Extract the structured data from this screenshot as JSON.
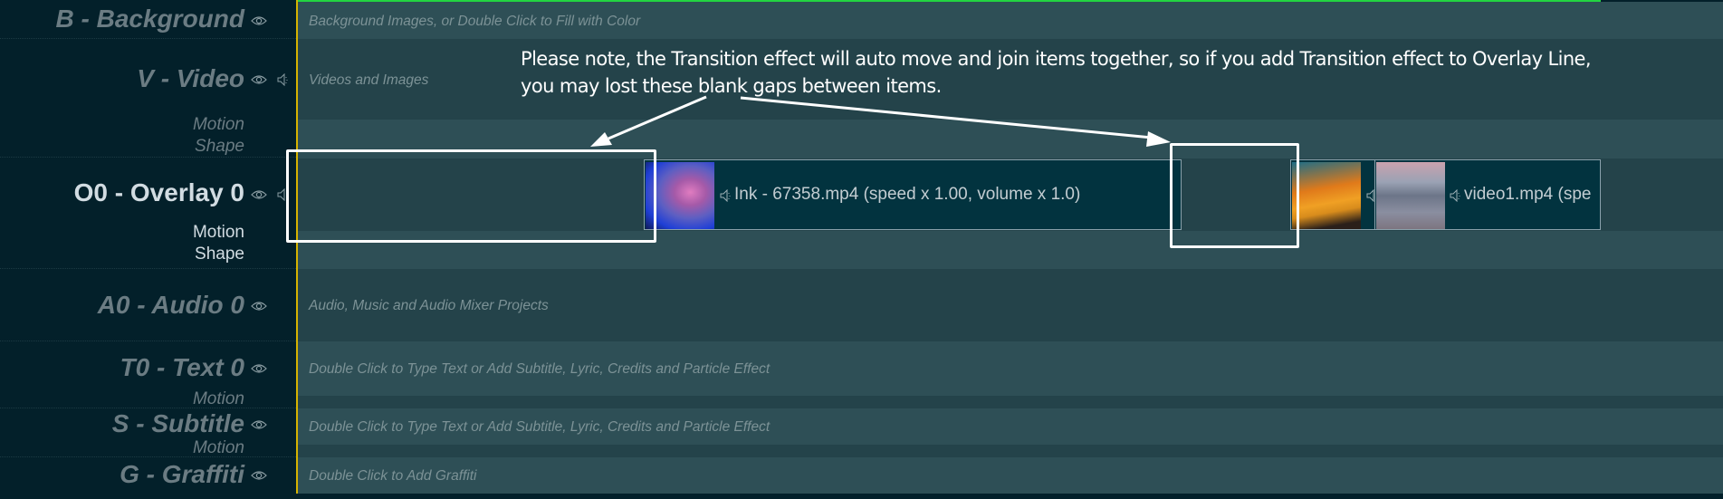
{
  "tracks": [
    {
      "id": "B",
      "label": "B - Background",
      "hint": "Background Images, or Double Click to Fill with Color",
      "icons": [
        "eye-icon"
      ]
    },
    {
      "id": "V",
      "label": "V - Video",
      "hint": "Videos and Images",
      "icons": [
        "eye-icon",
        "speaker-icon"
      ],
      "sub_labels": [
        "Motion",
        "Shape"
      ]
    },
    {
      "id": "O0",
      "label": "O0 - Overlay 0",
      "hint": "",
      "icons": [
        "eye-icon",
        "speaker-icon"
      ],
      "sub_labels": [
        "Motion",
        "Shape"
      ],
      "active": true
    },
    {
      "id": "A0",
      "label": "A0 - Audio 0",
      "hint": "Audio, Music and Audio Mixer Projects",
      "icons": [
        "eye-icon"
      ]
    },
    {
      "id": "T0",
      "label": "T0 - Text 0",
      "hint": "Double Click to Type Text or Add Subtitle, Lyric, Credits and Particle Effect",
      "icons": [
        "eye-icon"
      ],
      "sub_labels": [
        "Motion"
      ]
    },
    {
      "id": "S",
      "label": "S - Subtitle",
      "hint": "Double Click to Type Text or Add Subtitle, Lyric, Credits and Particle Effect",
      "icons": [
        "eye-icon"
      ],
      "sub_labels": [
        "Motion"
      ]
    },
    {
      "id": "G",
      "label": "G - Graffiti",
      "hint": "Double Click to Add Graffiti",
      "icons": [
        "eye-icon"
      ]
    }
  ],
  "clips": [
    {
      "name": "Ink - 67358.mp4",
      "details": "(speed x 1.00, volume x 1.0)",
      "label": "Ink - 67358.mp4  (speed x 1.00, volume x 1.0)",
      "thumbnail": "pink-blue-ink-smoke"
    },
    {
      "name": "",
      "label": "",
      "thumbnail": "orange-sunset-beach"
    },
    {
      "name": "video1.mp4",
      "label": "video1.mp4  (spe",
      "thumbnail": "woman-on-beach"
    }
  ],
  "annotation": {
    "line1": "Please note, the Transition effect will auto move and join items together, so if you add Transition effect to Overlay Line,",
    "line2": "you may lost these blank gaps between items."
  },
  "colors": {
    "playhead": "#d6b300",
    "progress": "#22d441",
    "panel": "#03202a",
    "lane_light": "#2e4f56",
    "lane_dark": "#24434a",
    "clip_bg": "#02333f"
  }
}
